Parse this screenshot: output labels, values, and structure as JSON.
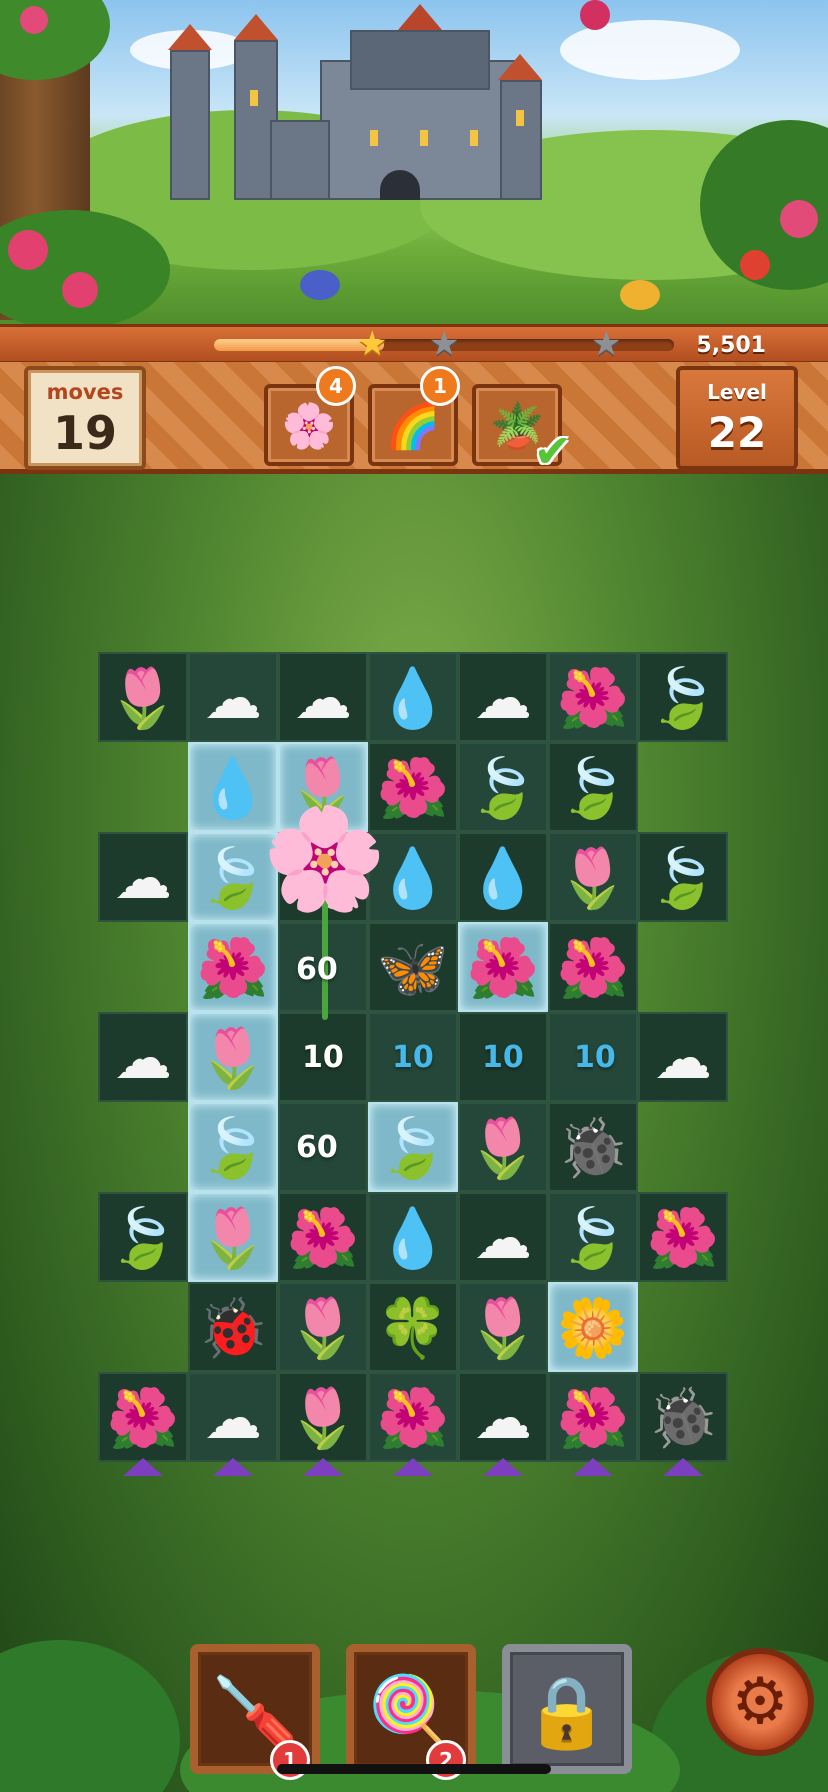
{
  "header": {
    "score": "5,501",
    "progress": 0.37,
    "stars": [
      "earned",
      "not-earned",
      "not-earned"
    ],
    "moves_label": "moves",
    "moves_value": "19",
    "level_label": "Level",
    "level_value": "22"
  },
  "goals": [
    {
      "icon": "pink-flower-icon",
      "glyph": "🌸",
      "count": "4"
    },
    {
      "icon": "rainbow-jar-icon",
      "glyph": "🌈",
      "count": "1"
    },
    {
      "icon": "potted-cactus-icon",
      "glyph": "🪴",
      "completed": true
    }
  ],
  "board": {
    "cols": 7,
    "rows": [
      [
        "tulip",
        "cotton",
        "cotton",
        "drop",
        "cotton",
        "red-flower",
        "leaf"
      ],
      [
        null,
        "drop",
        "tulip",
        "red-flower",
        "leaf",
        "leaf",
        null
      ],
      [
        "cotton",
        "leaf",
        "pink-flower",
        "drop",
        "drop",
        "tulip",
        "leaf"
      ],
      [
        null,
        "red-flower",
        "",
        "butterfly",
        "red-flower",
        "red-flower",
        null
      ],
      [
        "cotton",
        "tulip",
        "",
        "",
        "",
        "",
        "cotton"
      ],
      [
        null,
        "leaf",
        "",
        "leaf",
        "tulip",
        "bug-gray",
        null
      ],
      [
        "leaf",
        "tulip",
        "red-flower",
        "drop",
        "cotton",
        "leaf",
        "red-flower"
      ],
      [
        null,
        "bug-red",
        "tulip",
        "green-bomb",
        "tulip",
        "yellow-bomb",
        null
      ],
      [
        "red-flower",
        "cotton",
        "tulip",
        "red-flower",
        "cotton",
        "red-flower",
        "bug-gray"
      ]
    ],
    "ice": [
      [
        1,
        1
      ],
      [
        1,
        2
      ],
      [
        2,
        1
      ],
      [
        3,
        1
      ],
      [
        3,
        4
      ],
      [
        4,
        1
      ],
      [
        5,
        1
      ],
      [
        5,
        3
      ],
      [
        6,
        1
      ],
      [
        7,
        5
      ]
    ],
    "popups": [
      "60",
      "10",
      "10",
      "10",
      "10",
      "60"
    ]
  },
  "boosters": [
    {
      "name": "trowel-booster",
      "icon": "trowel-icon",
      "glyph": "🪛",
      "count": "1",
      "locked": false
    },
    {
      "name": "swirl-candy-booster",
      "icon": "swirl-icon",
      "glyph": "🍭",
      "count": "2",
      "locked": false
    },
    {
      "name": "locked-booster",
      "icon": "padlock-icon",
      "glyph": "🔒",
      "locked": true
    }
  ],
  "colors": {
    "accent": "#d86f37",
    "badge": "#ef7a1e",
    "count_badge": "#e23b3b",
    "check": "#57c53a"
  }
}
